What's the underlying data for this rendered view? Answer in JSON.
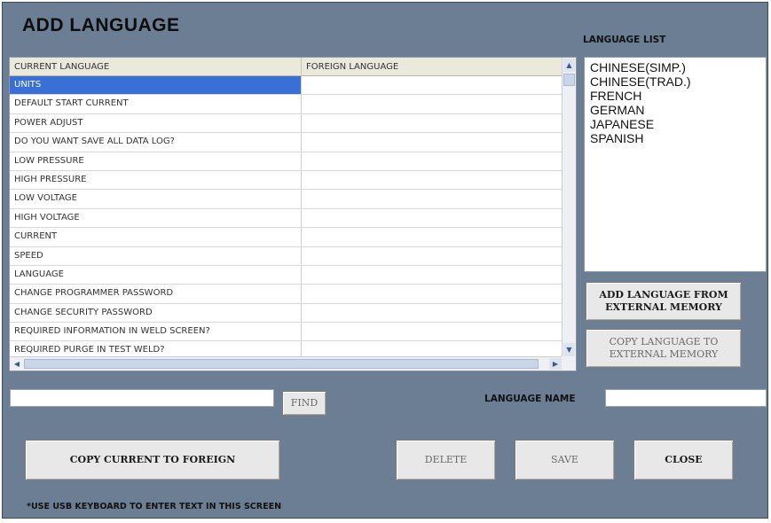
{
  "window": {
    "title": "ADD LANGUAGE"
  },
  "grid": {
    "columns": [
      "CURRENT LANGUAGE",
      "FOREIGN LANGUAGE"
    ],
    "rows": [
      {
        "current": "UNITS",
        "foreign": ""
      },
      {
        "current": "DEFAULT START CURRENT",
        "foreign": ""
      },
      {
        "current": "POWER ADJUST",
        "foreign": ""
      },
      {
        "current": "DO YOU WANT SAVE ALL DATA LOG?",
        "foreign": ""
      },
      {
        "current": "LOW PRESSURE",
        "foreign": ""
      },
      {
        "current": "HIGH PRESSURE",
        "foreign": ""
      },
      {
        "current": "LOW VOLTAGE",
        "foreign": ""
      },
      {
        "current": "HIGH VOLTAGE",
        "foreign": ""
      },
      {
        "current": "CURRENT",
        "foreign": ""
      },
      {
        "current": "SPEED",
        "foreign": ""
      },
      {
        "current": "LANGUAGE",
        "foreign": ""
      },
      {
        "current": "CHANGE PROGRAMMER PASSWORD",
        "foreign": ""
      },
      {
        "current": "CHANGE SECURITY PASSWORD",
        "foreign": ""
      },
      {
        "current": "REQUIRED INFORMATION IN WELD SCREEN?",
        "foreign": ""
      },
      {
        "current": "REQUIRED PURGE IN TEST WELD?",
        "foreign": ""
      }
    ],
    "selected_row": 0
  },
  "language_list": {
    "label": "LANGUAGE LIST",
    "items": [
      "CHINESE(SIMP.)",
      "CHINESE(TRAD.)",
      "FRENCH",
      "GERMAN",
      "JAPANESE",
      "SPANISH"
    ]
  },
  "buttons": {
    "add_from_external": "ADD LANGUAGE FROM EXTERNAL MEMORY",
    "copy_to_external": "COPY LANGUAGE TO EXTERNAL MEMORY",
    "find": "FIND",
    "copy_current_to_foreign": "COPY CURRENT TO FOREIGN",
    "delete": "DELETE",
    "save": "SAVE",
    "close": "CLOSE"
  },
  "search": {
    "value": ""
  },
  "language_name": {
    "label": "LANGUAGE NAME",
    "value": ""
  },
  "footer_note": "*USE USB KEYBOARD TO ENTER TEXT IN THIS SCREEN",
  "colors": {
    "window_bg": "#6b7e93",
    "selection": "#3a6fd6",
    "button_face": "#e8e8e8"
  },
  "icons": {
    "scroll_up": "triangle-up-icon",
    "scroll_down": "triangle-down-icon",
    "scroll_left": "triangle-left-icon",
    "scroll_right": "triangle-right-icon"
  }
}
